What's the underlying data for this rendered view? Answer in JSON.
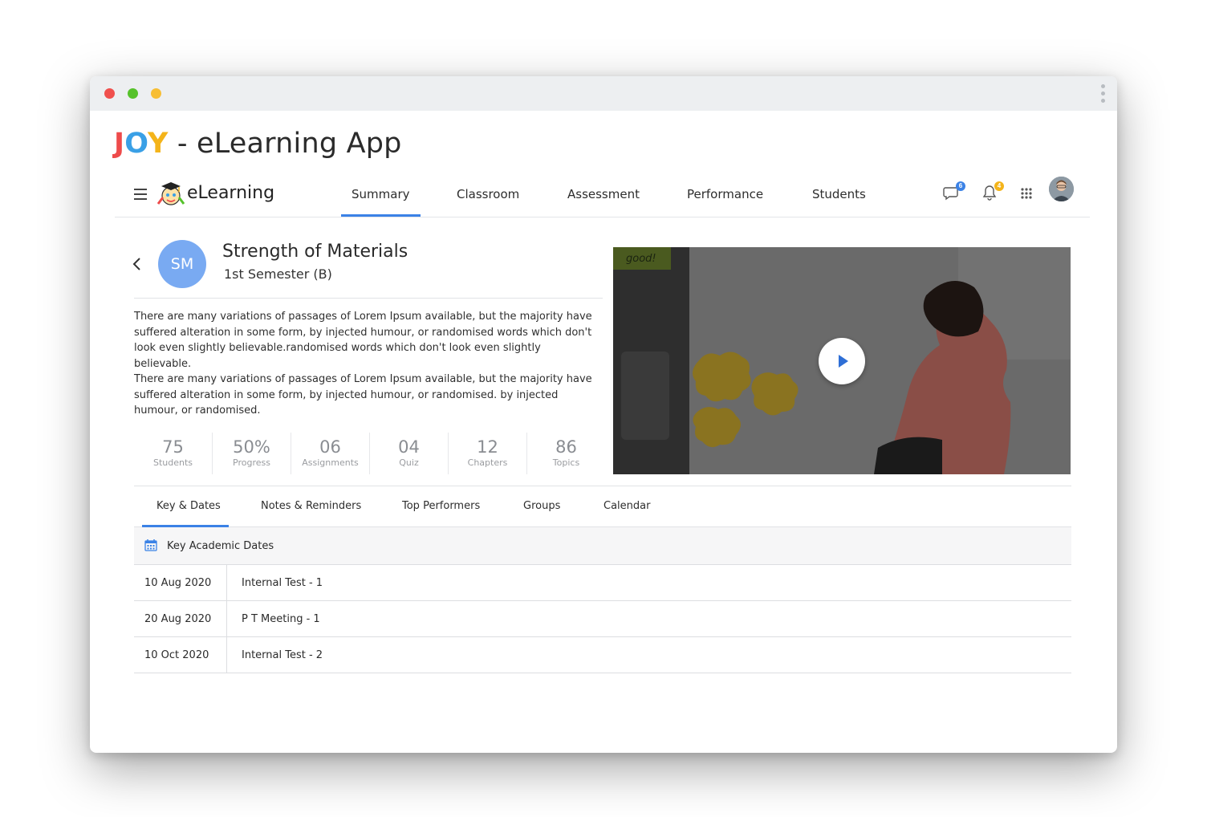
{
  "app_title": {
    "j": "J",
    "o": "O",
    "y": "Y",
    "rest": " - eLearning App"
  },
  "brand": {
    "name": "eLearning"
  },
  "nav": {
    "tabs": [
      {
        "label": "Summary"
      },
      {
        "label": "Classroom"
      },
      {
        "label": "Assessment"
      },
      {
        "label": "Performance"
      },
      {
        "label": "Students"
      }
    ],
    "active_tab": "Summary",
    "chat_badge": "6",
    "notification_badge": "4"
  },
  "course": {
    "initials": "SM",
    "title": "Strength of Materials",
    "subtitle": "1st Semester (B)",
    "paragraphs": [
      "There are many variations of passages of Lorem Ipsum available, but the majority have suffered alteration in some form, by injected humour, or randomised words which don't look even slightly believable.randomised words which don't look even slightly believable.",
      "There are many variations of passages of Lorem Ipsum available, but the majority have suffered alteration in some form, by injected humour, or randomised. by injected humour, or randomised."
    ]
  },
  "stats": [
    {
      "value": "75",
      "label": "Students"
    },
    {
      "value": "50%",
      "label": "Progress"
    },
    {
      "value": "06",
      "label": "Assignments"
    },
    {
      "value": "04",
      "label": "Quiz"
    },
    {
      "value": "12",
      "label": "Chapters"
    },
    {
      "value": "86",
      "label": "Topics"
    }
  ],
  "video": {
    "sign_text": "good!"
  },
  "subtabs": [
    {
      "label": "Key & Dates"
    },
    {
      "label": "Notes & Reminders"
    },
    {
      "label": "Top Performers"
    },
    {
      "label": "Groups"
    },
    {
      "label": "Calendar"
    }
  ],
  "active_subtab": "Key & Dates",
  "key_dates": {
    "heading": "Key Academic Dates",
    "rows": [
      {
        "date": "10 Aug 2020",
        "event": "Internal Test - 1"
      },
      {
        "date": "20 Aug 2020",
        "event": "P T Meeting - 1"
      },
      {
        "date": "10 Oct 2020",
        "event": "Internal Test - 2"
      }
    ]
  },
  "colors": {
    "accent": "#3b82e6",
    "avatar": "#79aaf2",
    "chat_badge": "#3b82e6",
    "bell_badge": "#f4b41a"
  }
}
